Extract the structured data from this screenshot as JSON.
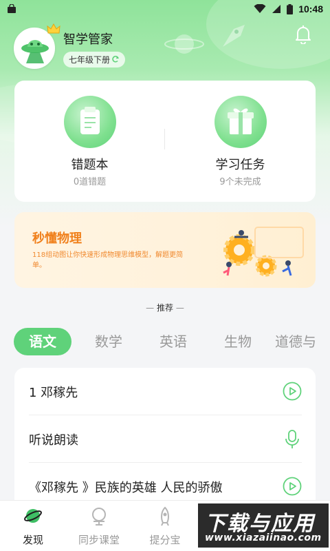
{
  "status_bar": {
    "time": "10:48"
  },
  "profile": {
    "name": "智学管家",
    "grade": "七年级下册"
  },
  "features": [
    {
      "title": "错题本",
      "subtitle": "0道错题",
      "icon": "clipboard-icon"
    },
    {
      "title": "学习任务",
      "subtitle": "9个未完成",
      "icon": "gift-box-icon"
    }
  ],
  "banner": {
    "title": "秒懂物理",
    "description": "118组动图让你快速形成物理思维模型，解题更简单。"
  },
  "recommend_label": "推荐",
  "subject_tabs": [
    "语文",
    "数学",
    "英语",
    "生物",
    "道德与"
  ],
  "active_tab": 0,
  "list_items": [
    {
      "text": "1 邓稼先",
      "action_icon": "play-icon"
    },
    {
      "text": "听说朗读",
      "action_icon": "microphone-icon"
    },
    {
      "text": "《邓稼先 》民族的英雄  人民的骄傲",
      "action_icon": "play-icon"
    }
  ],
  "bottom_nav": [
    "发现",
    "同步课堂",
    "提分宝"
  ],
  "watermark": {
    "line1": "下载与应用",
    "line2": "www.xiazaiinao.com"
  },
  "colors": {
    "accent": "#5fd27a",
    "banner_text": "#f0801c"
  }
}
